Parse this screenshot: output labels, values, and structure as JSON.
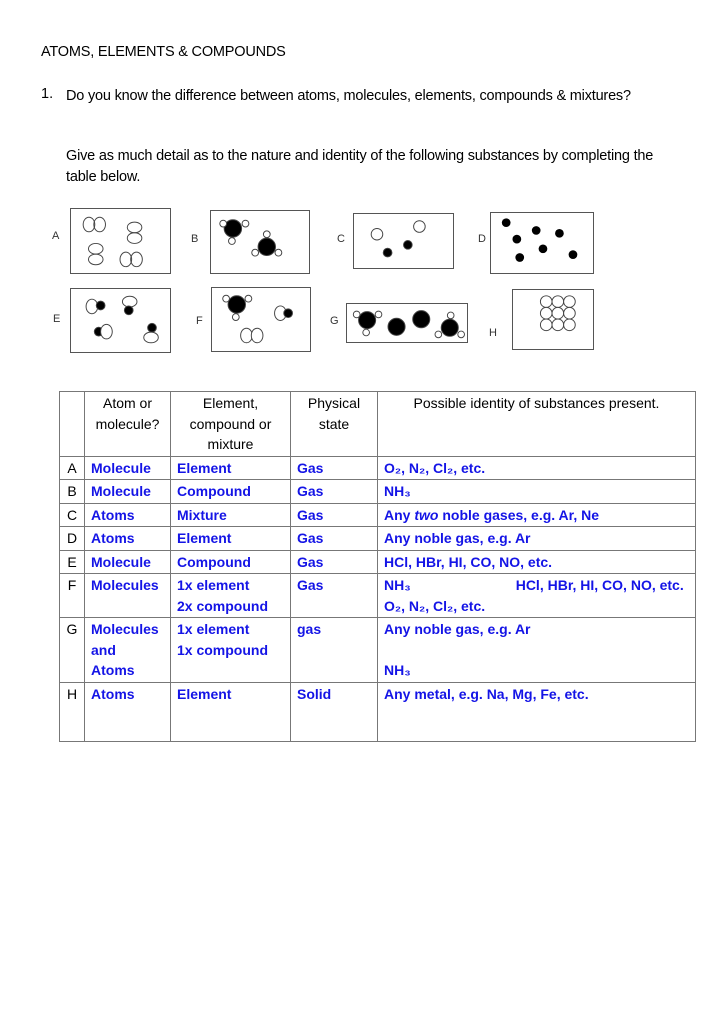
{
  "document": {
    "title": "ATOMS, ELEMENTS & COMPOUNDS",
    "question_number": "1.",
    "question_text": "Do you know the difference between atoms, molecules, elements, compounds & mixtures?",
    "instruction": "Give as much detail as to the nature and identity of the following substances by completing the table below."
  },
  "diagrams": [
    {
      "label": "A",
      "description": "four diatomic molecules of identical white atoms"
    },
    {
      "label": "B",
      "description": "two molecules with a large black atom bonded to three small white atoms"
    },
    {
      "label": "C",
      "description": "two white atoms and two black atoms, separate"
    },
    {
      "label": "D",
      "description": "seven separate black atoms"
    },
    {
      "label": "E",
      "description": "four diatomic molecules each of one white and one black atom"
    },
    {
      "label": "F",
      "description": "one black-with-three-white molecule, one white-black diatomic, one white-white diatomic"
    },
    {
      "label": "G",
      "description": "two black-with-three-white molecules and two separate black atoms"
    },
    {
      "label": "H",
      "description": "3x3 closely packed white atoms"
    }
  ],
  "table": {
    "headers": [
      "",
      "Atom or molecule?",
      "Element, compound or mixture",
      "Physical state",
      "Possible identity of substances present."
    ],
    "rows": [
      {
        "letter": "A",
        "atom_or_molecule": "Molecule",
        "classification": "Element",
        "state": "Gas",
        "identity": "O₂, N₂, Cl₂, etc."
      },
      {
        "letter": "B",
        "atom_or_molecule": "Molecule",
        "classification": "Compound",
        "state": "Gas",
        "identity": "NH₃"
      },
      {
        "letter": "C",
        "atom_or_molecule": "Atoms",
        "classification": "Mixture",
        "state": "Gas",
        "identity_pre": "Any ",
        "identity_em": "two",
        "identity_post": " noble gases, e.g.  Ar, Ne"
      },
      {
        "letter": "D",
        "atom_or_molecule": "Atoms",
        "classification": "Element",
        "state": "Gas",
        "identity": "Any noble gas, e.g. Ar"
      },
      {
        "letter": "E",
        "atom_or_molecule": "Molecule",
        "classification": "Compound",
        "state": "Gas",
        "identity": "HCl, HBr, HI, CO, NO, etc."
      },
      {
        "letter": "F",
        "atom_or_molecule": "Molecules",
        "classification_line1": "1x element",
        "classification_line2": "2x compound",
        "state": "Gas",
        "identity_line1a": "NH₃",
        "identity_line1b": "HCl, HBr, HI, CO, NO, etc.",
        "identity_line2": "O₂, N₂, Cl₂, etc."
      },
      {
        "letter": "G",
        "atom_or_molecule_line1": "Molecules",
        "atom_or_molecule_line2": "and",
        "atom_or_molecule_line3": "Atoms",
        "classification_line1": "1x element",
        "classification_line2": "1x compound",
        "state": "gas",
        "identity_line1": "Any noble gas, e.g. Ar",
        "identity_line3": "NH₃"
      },
      {
        "letter": "H",
        "atom_or_molecule": "Atoms",
        "classification": "Element",
        "state": "Solid",
        "identity": "Any metal, e.g. Na, Mg, Fe, etc."
      }
    ]
  },
  "colors": {
    "answer_text": "#1414e6",
    "border": "#777777"
  }
}
